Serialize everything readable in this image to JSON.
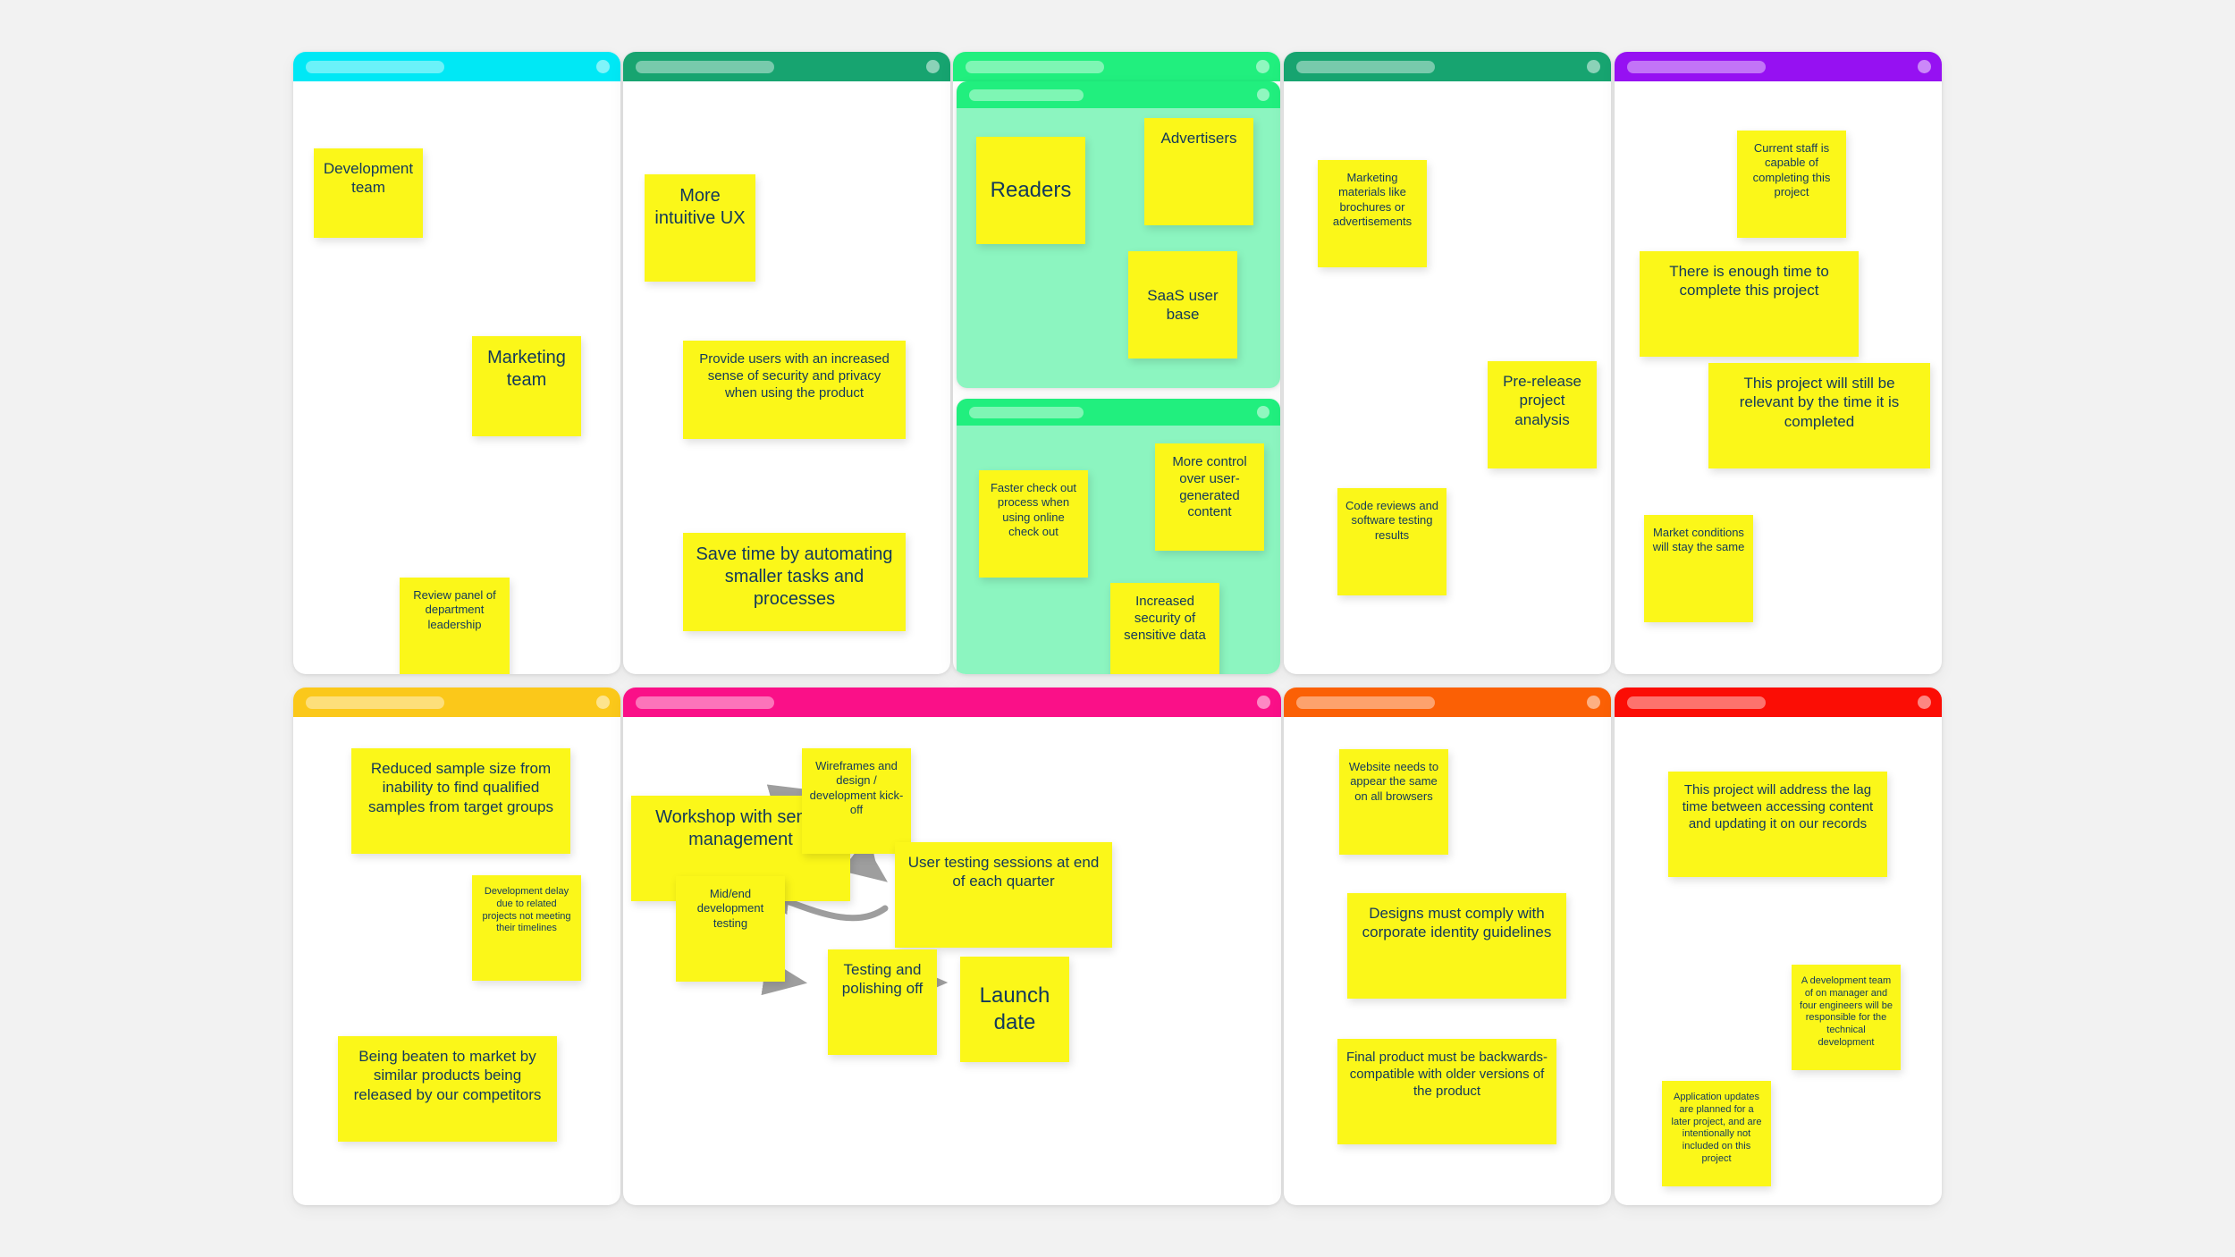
{
  "board": {
    "background_color": "#f2f2f2",
    "note_color": "#fbf719",
    "note_text_color": "#12385c",
    "arrow_color": "#9e9e9e"
  },
  "cards": [
    {
      "id": "stakeholders",
      "header_color": "#00e8f5",
      "body_color": "#ffffff",
      "notes": [
        {
          "text": "Development team"
        },
        {
          "text": "Marketing team"
        },
        {
          "text": "Review panel of department leadership"
        }
      ]
    },
    {
      "id": "goals",
      "header_color": "#17a470",
      "body_color": "#ffffff",
      "notes": [
        {
          "text": "More intuitive UX"
        },
        {
          "text": "Provide users with an increased sense of security and privacy when using the product"
        },
        {
          "text": "Save time by automating smaller tasks and processes"
        }
      ]
    },
    {
      "id": "users-and-benefits",
      "header_color": "#21ef7e",
      "body_color": "#ffffff",
      "panels": [
        {
          "id": "users",
          "header_color": "#21ef7e",
          "body_color": "#8cf5c0",
          "notes": [
            {
              "text": "Readers"
            },
            {
              "text": "Advertisers"
            },
            {
              "text": "SaaS user base"
            }
          ]
        },
        {
          "id": "benefits",
          "header_color": "#21ef7e",
          "body_color": "#8cf5c0",
          "notes": [
            {
              "text": "Faster check out process when using online check out"
            },
            {
              "text": "More control over user-generated content"
            },
            {
              "text": "Increased security of sensitive data"
            }
          ]
        }
      ]
    },
    {
      "id": "deliverables",
      "header_color": "#17a470",
      "body_color": "#ffffff",
      "notes": [
        {
          "text": "Marketing materials like brochures or advertisements"
        },
        {
          "text": "Pre-release project analysis"
        },
        {
          "text": "Code reviews and software testing results"
        }
      ]
    },
    {
      "id": "assumptions",
      "header_color": "#9611f2",
      "body_color": "#ffffff",
      "notes": [
        {
          "text": "Current staff is capable of completing this project"
        },
        {
          "text": "There is enough time to complete this project"
        },
        {
          "text": "This project will still be relevant by the time it is completed"
        },
        {
          "text": "Market conditions will stay the same"
        }
      ]
    },
    {
      "id": "risks",
      "header_color": "#fbc81a",
      "body_color": "#ffffff",
      "notes": [
        {
          "text": "Reduced sample size from inability to find qualified samples from target groups"
        },
        {
          "text": "Development delay due to related projects not meeting their timelines"
        },
        {
          "text": "Being beaten to market by similar products being released by our competitors"
        }
      ]
    },
    {
      "id": "milestones",
      "header_color": "#fa1088",
      "body_color": "#ffffff",
      "notes": [
        {
          "text": "Workshop with senior management"
        },
        {
          "text": "Wireframes and design / development kick-off"
        },
        {
          "text": "User testing sessions at end of each quarter"
        },
        {
          "text": "Mid/end development testing"
        },
        {
          "text": "Testing and polishing off"
        },
        {
          "text": "Launch date"
        }
      ],
      "connections": [
        {
          "from": "Workshop with senior management",
          "to": "Wireframes and design / development kick-off"
        },
        {
          "from": "Wireframes and design / development kick-off",
          "to": "User testing sessions at end of each quarter"
        },
        {
          "from": "User testing sessions at end of each quarter",
          "to": "Mid/end development testing"
        },
        {
          "from": "Mid/end development testing",
          "to": "Testing and polishing off"
        },
        {
          "from": "Testing and polishing off",
          "to": "Launch date"
        }
      ]
    },
    {
      "id": "requirements",
      "header_color": "#fb6005",
      "body_color": "#ffffff",
      "notes": [
        {
          "text": "Website needs to appear the same on all browsers"
        },
        {
          "text": "Designs must comply with corporate identity guidelines"
        },
        {
          "text": "Final product must be backwards-compatible with older versions of the product"
        }
      ]
    },
    {
      "id": "scope",
      "header_color": "#fb0d05",
      "body_color": "#ffffff",
      "notes": [
        {
          "text": "This project will address the lag time between accessing content and updating it on our records"
        },
        {
          "text": "A development team of on manager and four engineers will be responsible for the technical development"
        },
        {
          "text": "Application updates are planned for a later project, and are intentionally not included on this project"
        }
      ]
    }
  ]
}
